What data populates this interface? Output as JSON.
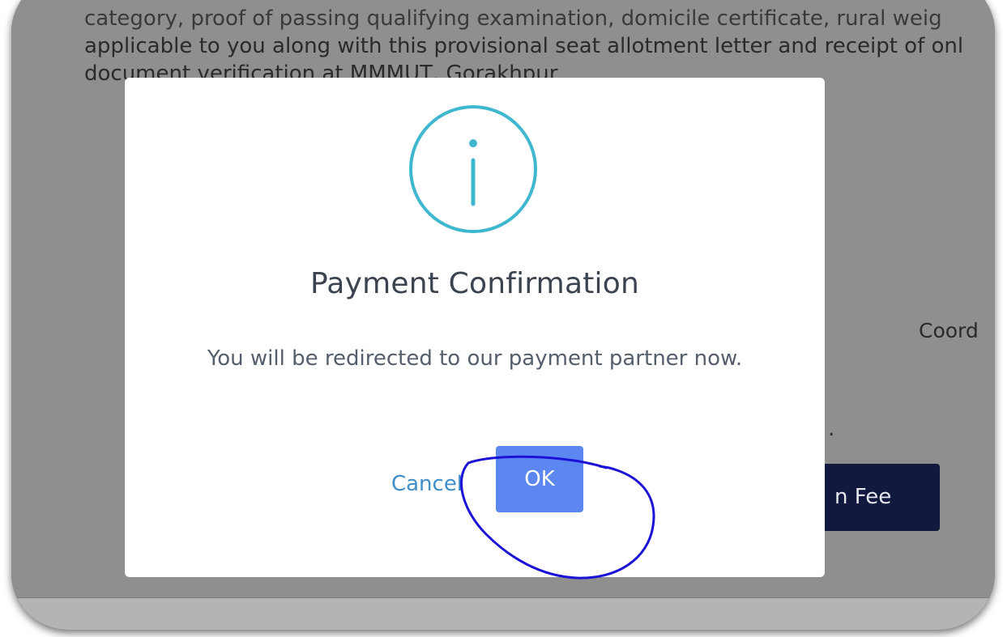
{
  "background": {
    "lines": [
      "category, proof of passing qualifying examination, domicile certificate, rural weig",
      "applicable to you along with this provisional seat allotment letter and receipt of onl",
      "document verification at MMMUT, Gorakhpur"
    ],
    "coord_text": "Coord",
    "dot_text": ".",
    "pay_button_label": "n Fee"
  },
  "dialog": {
    "icon": "info-icon",
    "title": "Payment Confirmation",
    "message": "You will be redirected to our payment partner now.",
    "cancel_label": "Cancel",
    "ok_label": "OK"
  },
  "colors": {
    "overlay": "#8f8f8f",
    "info_icon": "#3fb8cf",
    "ok_button": "#5c87f0",
    "cancel_link": "#3e8fc9",
    "annotation_ink": "#1b12d6",
    "pay_button": "#111a3e"
  }
}
